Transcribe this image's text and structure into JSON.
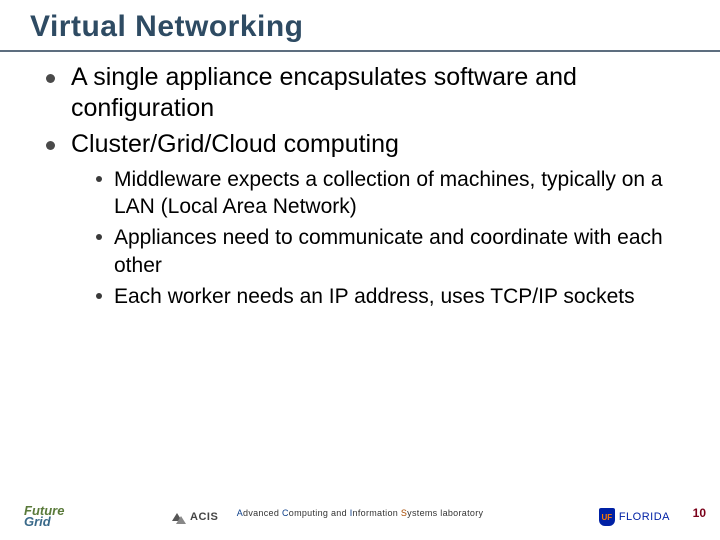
{
  "title": "Virtual Networking",
  "bullets": [
    {
      "text": "A single appliance encapsulates software and configuration"
    },
    {
      "text": "Cluster/Grid/Cloud computing",
      "sub": [
        "Middleware expects a collection of machines, typically on a LAN (Local Area Network)",
        "Appliances need to communicate and coordinate with each other",
        "Each worker needs an IP address, uses TCP/IP sockets"
      ]
    }
  ],
  "footer": {
    "lab_a": "A",
    "lab_mid1": "dvanced ",
    "lab_c": "C",
    "lab_mid2": "omputing and ",
    "lab_i": "I",
    "lab_mid3": "nformation ",
    "lab_s": "S",
    "lab_end": "ystems laboratory"
  },
  "logos": {
    "future": "Future",
    "grid": "Grid",
    "acis": "ACIS",
    "uf_shield": "UF",
    "uf_word": "FLORIDA"
  },
  "page_number": "10"
}
